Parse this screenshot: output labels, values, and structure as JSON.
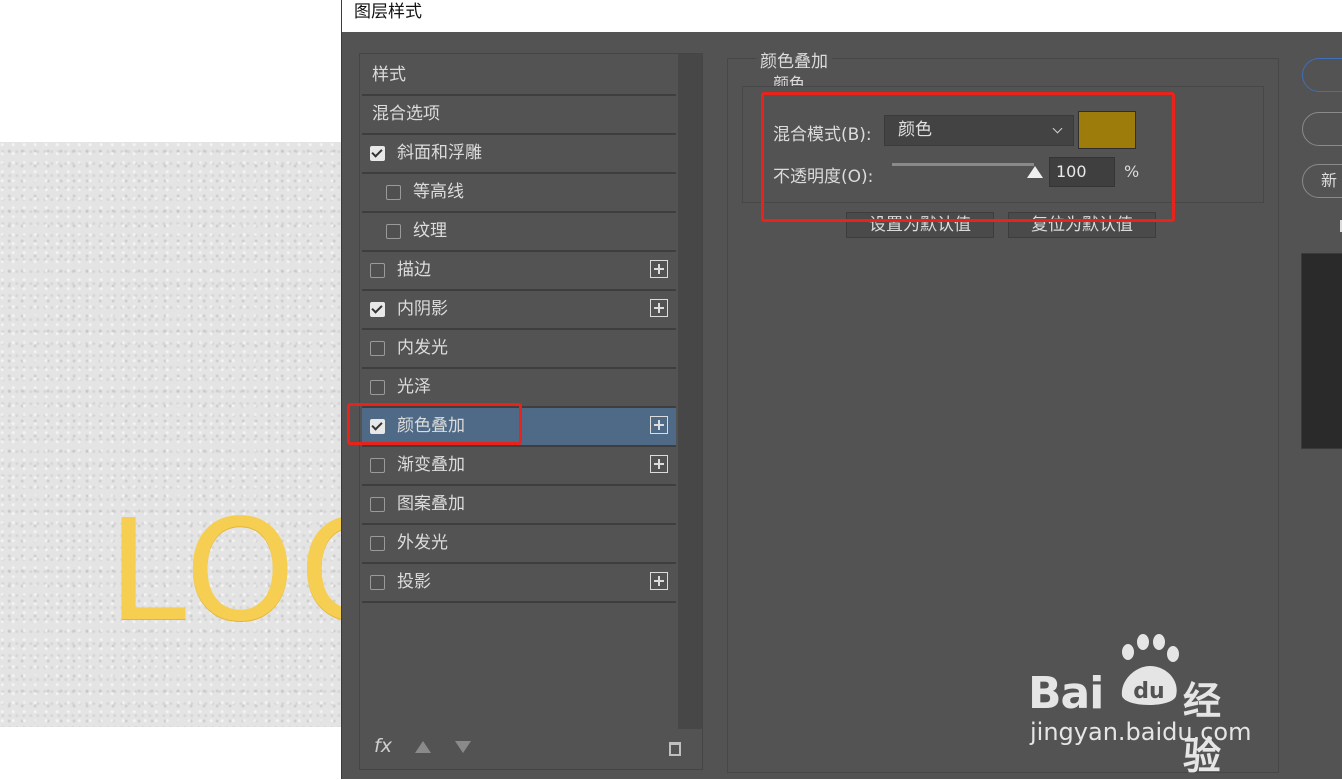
{
  "dialog": {
    "title": "图层样式"
  },
  "canvas": {
    "logo_text": "LOC"
  },
  "style_list": {
    "items": [
      {
        "label": "样式",
        "checkbox": false,
        "checked": false,
        "plus": false,
        "selected": false
      },
      {
        "label": "混合选项",
        "checkbox": false,
        "checked": false,
        "plus": false,
        "selected": false
      },
      {
        "label": "斜面和浮雕",
        "checkbox": true,
        "checked": true,
        "plus": false,
        "selected": false
      },
      {
        "label": "等高线",
        "checkbox": true,
        "checked": false,
        "plus": false,
        "selected": false,
        "indent": true
      },
      {
        "label": "纹理",
        "checkbox": true,
        "checked": false,
        "plus": false,
        "selected": false,
        "indent": true
      },
      {
        "label": "描边",
        "checkbox": true,
        "checked": false,
        "plus": true,
        "selected": false
      },
      {
        "label": "内阴影",
        "checkbox": true,
        "checked": true,
        "plus": true,
        "selected": false
      },
      {
        "label": "内发光",
        "checkbox": true,
        "checked": false,
        "plus": false,
        "selected": false
      },
      {
        "label": "光泽",
        "checkbox": true,
        "checked": false,
        "plus": false,
        "selected": false
      },
      {
        "label": "颜色叠加",
        "checkbox": true,
        "checked": true,
        "plus": true,
        "selected": true
      },
      {
        "label": "渐变叠加",
        "checkbox": true,
        "checked": false,
        "plus": true,
        "selected": false
      },
      {
        "label": "图案叠加",
        "checkbox": true,
        "checked": false,
        "plus": false,
        "selected": false
      },
      {
        "label": "外发光",
        "checkbox": true,
        "checked": false,
        "plus": false,
        "selected": false
      },
      {
        "label": "投影",
        "checkbox": true,
        "checked": false,
        "plus": true,
        "selected": false
      }
    ],
    "fx_label": "fx"
  },
  "color_overlay": {
    "group_title": "颜色叠加",
    "sub_title": "颜色",
    "blend_mode_label": "混合模式(B):",
    "blend_mode_value": "颜色",
    "swatch_color": "#9e7c0c",
    "opacity_label": "不透明度(O):",
    "opacity_value": "100",
    "opacity_level": 1.0,
    "percent": "%",
    "set_default_label": "设置为默认值",
    "reset_default_label": "复位为默认值"
  },
  "right_edge": {
    "button_partial": "新"
  },
  "watermark": {
    "brand": "Bai",
    "brand_du": "du",
    "product": "经验",
    "url": "jingyan.baidu.com"
  },
  "colors": {
    "highlight": "#e8231b",
    "selected_row": "#4f6a86",
    "dialog_bg": "#535353"
  }
}
